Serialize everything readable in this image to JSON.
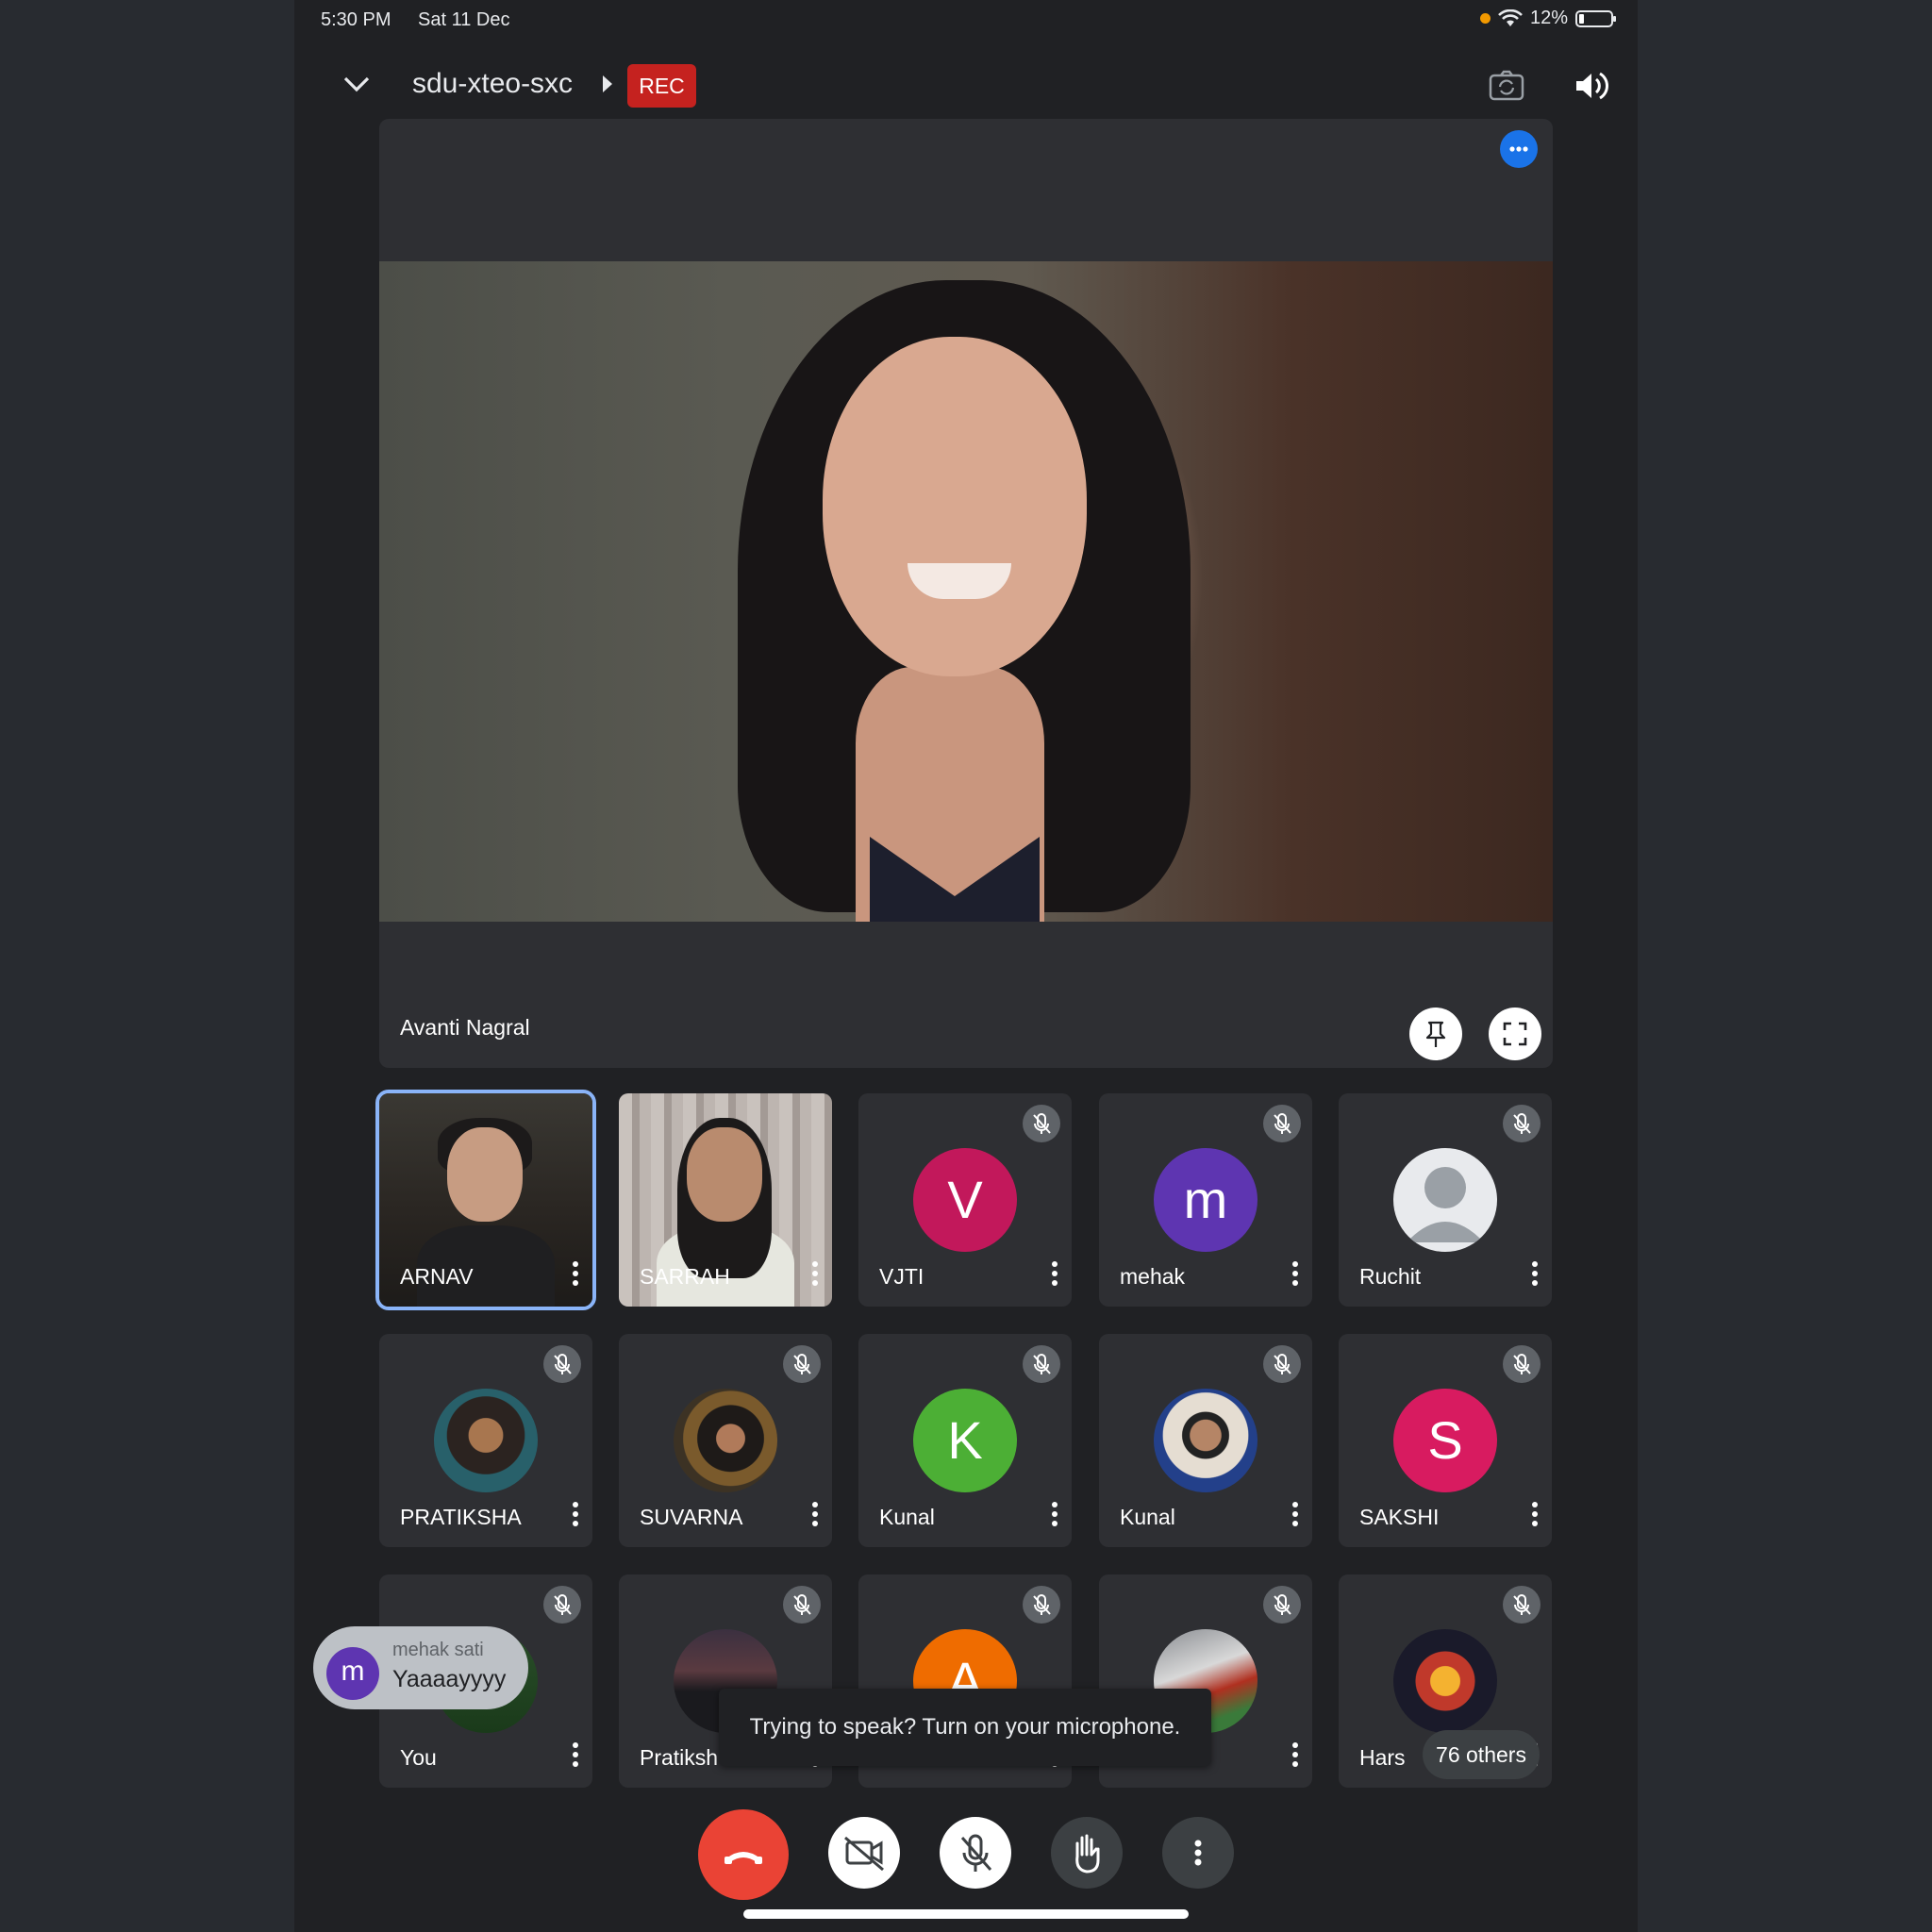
{
  "status_bar": {
    "time": "5:30 PM",
    "date": "Sat 11 Dec",
    "battery": "12%"
  },
  "header": {
    "meeting_code": "sdu-xteo-sxc",
    "rec_label": "REC"
  },
  "spotlight": {
    "name": "Avanti Nagral"
  },
  "tiles": [
    {
      "name": "ARNAV"
    },
    {
      "name": "SARRAH"
    },
    {
      "name": "VJTI",
      "initial": "V",
      "color": "#c2185b"
    },
    {
      "name": "mehak",
      "initial": "m",
      "color": "#5e35b1"
    },
    {
      "name": "Ruchit"
    },
    {
      "name": "PRATIKSHA"
    },
    {
      "name": "SUVARNA"
    },
    {
      "name": "Kunal",
      "initial": "K",
      "color": "#4caf35"
    },
    {
      "name": "Kunal"
    },
    {
      "name": "SAKSHI",
      "initial": "S",
      "color": "#d81b60"
    },
    {
      "name": "You"
    },
    {
      "name": "Pratiksh"
    },
    {
      "name": "",
      "initial": "A",
      "color": "#ef6c00"
    },
    {
      "name": ""
    },
    {
      "name": "Hars"
    }
  ],
  "others": {
    "label": "76 others"
  },
  "chat_bubble": {
    "initial": "m",
    "sender": "mehak sati",
    "message": "Yaaaayyyy"
  },
  "toast": {
    "text": "Trying to speak? Turn on your microphone."
  }
}
